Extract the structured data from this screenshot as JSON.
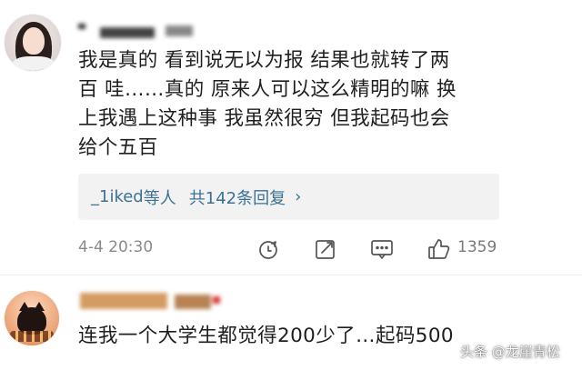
{
  "comments": [
    {
      "text_lines": [
        "我是真的 看到说无以为报 结果也就转了两",
        "百 哇……真的 原来人可以这么精明的嘛 换",
        "上我遇上这种事 我虽然很穷 但我起码也会",
        "给个五百"
      ],
      "replies": {
        "names": "_1iked",
        "others": "等人",
        "count_text": "共142条回复",
        "arrow": "›"
      },
      "timestamp": "4-4 20:30",
      "likes": "1359",
      "icons": [
        "repost-icon",
        "edit-icon",
        "comment-icon",
        "like-icon"
      ]
    },
    {
      "text_lines": [
        "连我一个大学生都觉得200少了…起码500"
      ]
    }
  ],
  "watermark": "头条 @龙崖青松"
}
